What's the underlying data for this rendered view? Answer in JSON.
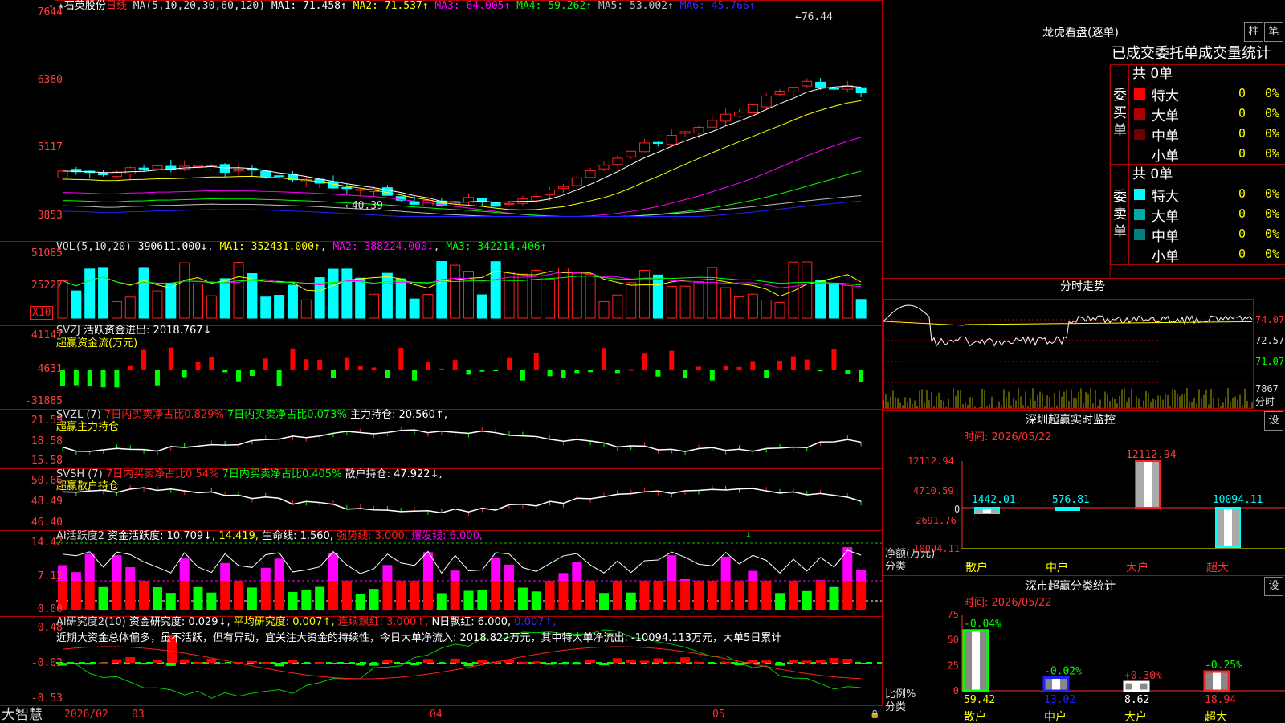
{
  "main": {
    "stock_name": "石英股份",
    "period": "日线",
    "ma_params": "MA(5,10,20,30,60,120)",
    "ma1": "MA1: 71.458↑",
    "ma2": "MA2: 71.537↑",
    "ma3": "MA3: 64.005↑",
    "ma4": "MA4: 59.262↑",
    "ma5": "MA5: 53.002↑",
    "ma6": "MA6: 45.766↑",
    "y_labels": [
      "7644",
      "6380",
      "5117",
      "3853"
    ],
    "high_mark": "76.44",
    "low_mark": "40.39",
    "colors": {
      "up": "#ff2020",
      "down": "#00ffff",
      "ma1": "#ffffff",
      "ma2": "#ffff00",
      "ma3": "#ff00ff",
      "ma4": "#00ff00",
      "ma5": "#c0c0c0",
      "ma6": "#2020ff"
    }
  },
  "vol": {
    "title": "VOL(5,10,20)",
    "value": "390611.000↓",
    "ma1": "MA1: 352431.000↑",
    "ma2": "MA2: 388224.000↓",
    "ma3": "MA3: 342214.406↑",
    "y_labels": [
      "51085",
      "25227"
    ],
    "unit": "X10"
  },
  "svzj": {
    "title": "SVZJ",
    "line1": "活跃资金进出: 2018.767↓",
    "line2": "超赢资金流(万元)",
    "y_labels": [
      "41147",
      "4631",
      "-31885"
    ]
  },
  "svzl": {
    "title": "SVZL (7)",
    "a": "7日内买卖净占比0.829%",
    "b": "7日内买卖净占比0.073%",
    "c": "主力持仓: 20.560↑,",
    "line2": "超赢主力持仓",
    "y_labels": [
      "21.59",
      "18.58",
      "15.58"
    ]
  },
  "svsh": {
    "title": "SVSH (7)",
    "a": "7日内买卖净占比0.54%",
    "b": "7日内买卖净占比0.405%",
    "c": "散户持仓: 47.922↓,",
    "line2": "超赢散户持仓",
    "y_labels": [
      "50.66",
      "48.49",
      "46.40"
    ]
  },
  "ai1": {
    "title": "AI活跃度2",
    "a": "资金活跃度: 10.709↓,",
    "b": "14.419,",
    "c": "生命线: 1.560,",
    "d": "强势线: 3.000,",
    "e": "爆发线: 6.000,",
    "y_labels": [
      "14.42",
      "7.12",
      "0.00"
    ]
  },
  "ai2": {
    "title": "AI研究度2(10)",
    "a": "资金研究度: 0.029↓,",
    "b": "平均研究度: 0.007↑,",
    "c": "连续飘红: 3.000↑,",
    "d": "N日飘红: 6.000,",
    "e": "0.007↑,",
    "comment": "近期大资金总体偏多，虽不活跃，但有异动，宜关注大资金的持续性，今日大单净流入: 2018.822万元，其中特大单净流出: -10094.113万元，大单5日累计",
    "y_labels": [
      "0.48",
      "-0.02",
      "-0.53"
    ]
  },
  "xaxis": {
    "brand": "大智慧",
    "labels": [
      "2026/02",
      "03",
      "04",
      "05"
    ]
  },
  "lhb": {
    "title": "龙虎看盘(逐单)",
    "btn_zhu": "柱",
    "btn_bi": "笔",
    "header": "已成交委托单成交量统计",
    "buy_label": "委买单",
    "sell_label": "委卖单",
    "buy_total": "共 0单",
    "sell_total": "共 0单",
    "buy_rows": [
      {
        "name": "特大",
        "n": "0",
        "p": "0%",
        "color": "#ff0000"
      },
      {
        "name": "大单",
        "n": "0",
        "p": "0%",
        "color": "#aa0000"
      },
      {
        "name": "中单",
        "n": "0",
        "p": "0%",
        "color": "#700000"
      },
      {
        "name": "小单",
        "n": "0",
        "p": "0%",
        "color": "#000000"
      }
    ],
    "sell_rows": [
      {
        "name": "特大",
        "n": "0",
        "p": "0%",
        "color": "#00ffff"
      },
      {
        "name": "大单",
        "n": "0",
        "p": "0%",
        "color": "#00aaaa"
      },
      {
        "name": "中单",
        "n": "0",
        "p": "0%",
        "color": "#008080"
      },
      {
        "name": "小单",
        "n": "0",
        "p": "0%",
        "color": "#000000"
      }
    ]
  },
  "intraday": {
    "title": "分时走势",
    "y_labels": [
      "74.07",
      "72.57",
      "71.07"
    ],
    "vol_label": "7867",
    "tag": "分时"
  },
  "monitor": {
    "title": "深圳超赢实时监控",
    "btn": "设",
    "time": "时间: 2026/05/22",
    "y_labels": [
      "12112.94",
      "4710.59",
      "0",
      "-2691.76",
      "-10094.11"
    ],
    "ylabel1": "净额(万元)",
    "ylabel2": "分类",
    "categories": [
      "散户",
      "中户",
      "大户",
      "超大"
    ],
    "values": [
      "-1442.01",
      "-576.81",
      "12112.94",
      "-10094.11"
    ]
  },
  "classify": {
    "title": "深市超赢分类统计",
    "btn": "设",
    "time": "时间: 2026/05/22",
    "y_labels": [
      "75",
      "50",
      "25",
      "0"
    ],
    "ylabel1": "比例%",
    "ylabel2": "分类",
    "categories": [
      "散户",
      "中户",
      "大户",
      "超大"
    ],
    "values": [
      "59.42",
      "13.02",
      "8.62",
      "18.94"
    ],
    "changes": [
      "-0.04%",
      "-0.02%",
      "+0.30%",
      "-0.25%"
    ]
  },
  "chart_data": [
    {
      "type": "bar",
      "title": "深圳超赢实时监控",
      "ylabel": "净额(万元)",
      "categories": [
        "散户",
        "中户",
        "大户",
        "超大"
      ],
      "values": [
        -1442.01,
        -576.81,
        12112.94,
        -10094.11
      ],
      "ylim": [
        -10094.11,
        12112.94
      ]
    },
    {
      "type": "bar",
      "title": "深市超赢分类统计",
      "ylabel": "比例%",
      "categories": [
        "散户",
        "中户",
        "大户",
        "超大"
      ],
      "values": [
        59.42,
        13.02,
        8.62,
        18.94
      ],
      "ylim": [
        0,
        75
      ]
    },
    {
      "type": "line",
      "title": "MA",
      "series": [
        {
          "name": "MA1",
          "values": [
            71.458
          ]
        },
        {
          "name": "MA2",
          "values": [
            71.537
          ]
        },
        {
          "name": "MA3",
          "values": [
            64.005
          ]
        },
        {
          "name": "MA4",
          "values": [
            59.262
          ]
        },
        {
          "name": "MA5",
          "values": [
            53.002
          ]
        },
        {
          "name": "MA6",
          "values": [
            45.766
          ]
        }
      ],
      "ylim": [
        38.53,
        76.44
      ]
    }
  ]
}
